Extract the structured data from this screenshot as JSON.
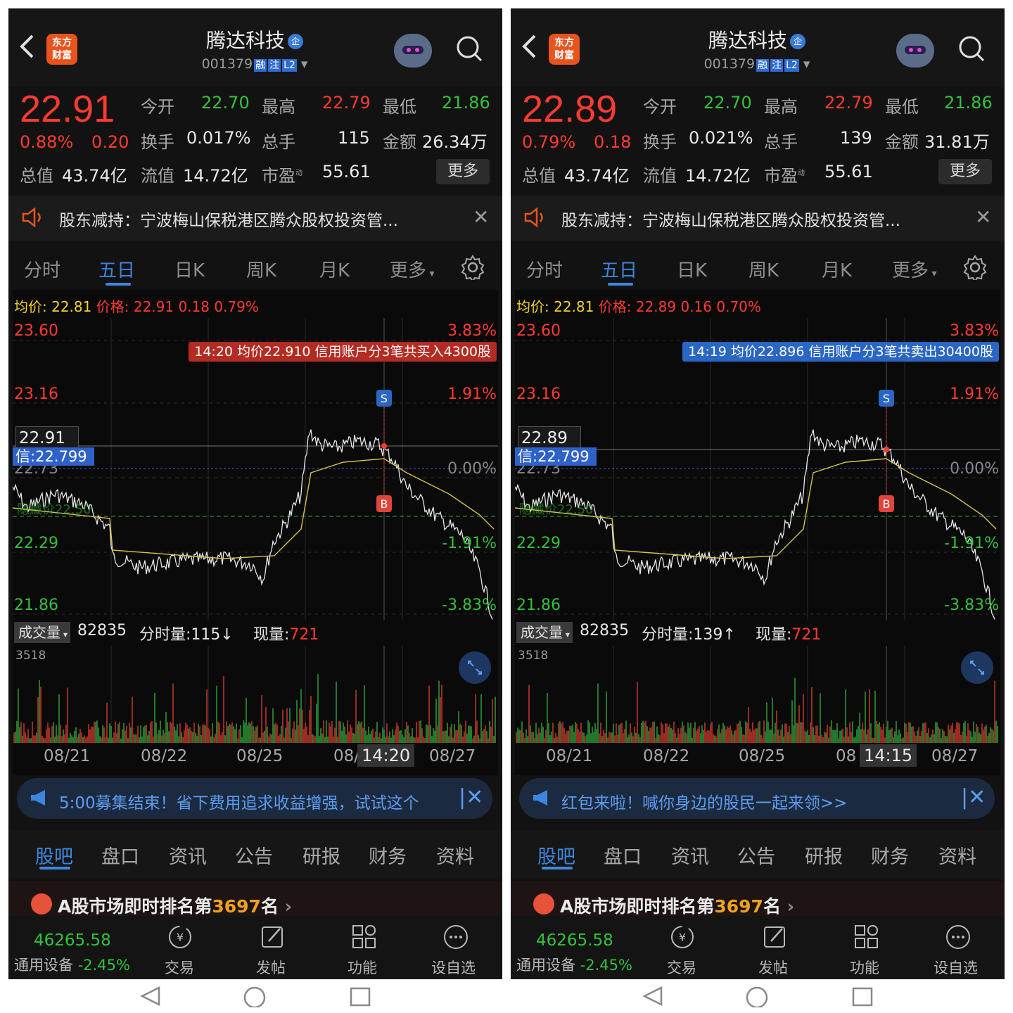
{
  "panels": [
    {
      "stock_name": "腾达科技",
      "verified_badge": "企",
      "stock_code": "001379",
      "code_tags": [
        "融",
        "注",
        "L2"
      ],
      "logo_text": [
        "东方",
        "财富"
      ],
      "price": "22.91",
      "change_pct": "0.88%",
      "change_abs": "0.20",
      "stats": {
        "open_label": "今开",
        "open": "22.70",
        "high_label": "最高",
        "high": "22.79",
        "low_label": "最低",
        "low": "21.86",
        "turnover_label": "换手",
        "turnover": "0.017%",
        "volume_label": "总手",
        "volume": "115",
        "amount_label": "金额",
        "amount": "26.34万",
        "mktcap_label": "总值",
        "mktcap": "43.74亿",
        "float_label": "流值",
        "float": "14.72亿",
        "pe_label": "市盈",
        "pe_sup": "动",
        "pe": "55.61",
        "more_label": "更多"
      },
      "notice": "股东减持：宁波梅山保税港区腾众股权投资管...",
      "tabs": [
        "分时",
        "五日",
        "日K",
        "周K",
        "月K",
        "更多"
      ],
      "active_tab": "五日",
      "avg_label": "均价:",
      "avg_value": "22.81",
      "price_label": "价格:",
      "price_value": "22.91",
      "price_chg": "0.18",
      "price_pct": "0.79%",
      "y_labels_left": [
        "23.60",
        "23.16",
        "22.73",
        "22.29",
        "21.86"
      ],
      "y_labels_right": [
        "3.83%",
        "1.91%",
        "0.00%",
        "-1.91%",
        "-3.83%"
      ],
      "trade_tooltip": "14:20  均价22.910  信用账户分3笔共买入4300股",
      "trade_color": "#b42b22",
      "current_price_tag": "22.91",
      "credit_tag": "信:22.799",
      "cost_label": "隐藏价22.50",
      "marker_s": "S",
      "marker_b": "B",
      "volume_dropdown": "成交量",
      "volume_total": "82835",
      "volume_tick_label": "分时量:",
      "volume_tick": "115↓",
      "now_vol_label": "现量:",
      "now_vol": "721",
      "volume_max": "3518",
      "dates": [
        "08/21",
        "08/22",
        "08/25",
        "08/",
        "08/27"
      ],
      "cursor_time": "14:20",
      "banner_text": "5:00募集结束！省下费用追求收益增强，试试这个",
      "bottom_tabs": [
        "股吧",
        "盘口",
        "资讯",
        "公告",
        "研报",
        "财务",
        "资料"
      ],
      "rank_prefix": "A股市场即时排名第",
      "rank_num": "3697",
      "rank_suffix": "名",
      "index_value": "46265.58",
      "industry_name": "通用设备",
      "industry_pct": "-2.45%",
      "footer_actions": [
        "交易",
        "发帖",
        "功能",
        "设自选"
      ]
    },
    {
      "stock_name": "腾达科技",
      "verified_badge": "企",
      "stock_code": "001379",
      "code_tags": [
        "融",
        "注",
        "L2"
      ],
      "logo_text": [
        "东方",
        "财富"
      ],
      "price": "22.89",
      "change_pct": "0.79%",
      "change_abs": "0.18",
      "stats": {
        "open_label": "今开",
        "open": "22.70",
        "high_label": "最高",
        "high": "22.79",
        "low_label": "最低",
        "low": "21.86",
        "turnover_label": "换手",
        "turnover": "0.021%",
        "volume_label": "总手",
        "volume": "139",
        "amount_label": "金额",
        "amount": "31.81万",
        "mktcap_label": "总值",
        "mktcap": "43.74亿",
        "float_label": "流值",
        "float": "14.72亿",
        "pe_label": "市盈",
        "pe_sup": "动",
        "pe": "55.61",
        "more_label": "更多"
      },
      "notice": "股东减持：宁波梅山保税港区腾众股权投资管...",
      "tabs": [
        "分时",
        "五日",
        "日K",
        "周K",
        "月K",
        "更多"
      ],
      "active_tab": "五日",
      "avg_label": "均价:",
      "avg_value": "22.81",
      "price_label": "价格:",
      "price_value": "22.89",
      "price_chg": "0.16",
      "price_pct": "0.70%",
      "y_labels_left": [
        "23.60",
        "23.16",
        "22.73",
        "22.29",
        "21.86"
      ],
      "y_labels_right": [
        "3.83%",
        "1.91%",
        "0.00%",
        "-1.91%",
        "-3.83%"
      ],
      "trade_tooltip": "14:19  均价22.896  信用账户分3笔共卖出30400股",
      "trade_color": "#2a66c4",
      "current_price_tag": "22.89",
      "credit_tag": "信:22.799",
      "cost_label": "隐藏价22.50",
      "marker_s": "S",
      "marker_b": "B",
      "volume_dropdown": "成交量",
      "volume_total": "82835",
      "volume_tick_label": "分时量:",
      "volume_tick": "139↑",
      "now_vol_label": "现量:",
      "now_vol": "721",
      "volume_max": "3518",
      "dates": [
        "08/21",
        "08/22",
        "08/25",
        "08",
        "08/27"
      ],
      "cursor_time": "14:15",
      "banner_text": "红包来啦！喊你身边的股民一起来领>>",
      "bottom_tabs": [
        "股吧",
        "盘口",
        "资讯",
        "公告",
        "研报",
        "财务",
        "资料"
      ],
      "rank_prefix": "A股市场即时排名第",
      "rank_num": "3697",
      "rank_suffix": "名",
      "index_value": "46265.58",
      "industry_name": "通用设备",
      "industry_pct": "-2.45%",
      "footer_actions": [
        "交易",
        "发帖",
        "功能",
        "设自选"
      ]
    }
  ],
  "colors": {
    "up": "#ff3b30",
    "down": "#33c23c",
    "accent": "#3d86e0",
    "avg_line": "#d8c24a"
  }
}
